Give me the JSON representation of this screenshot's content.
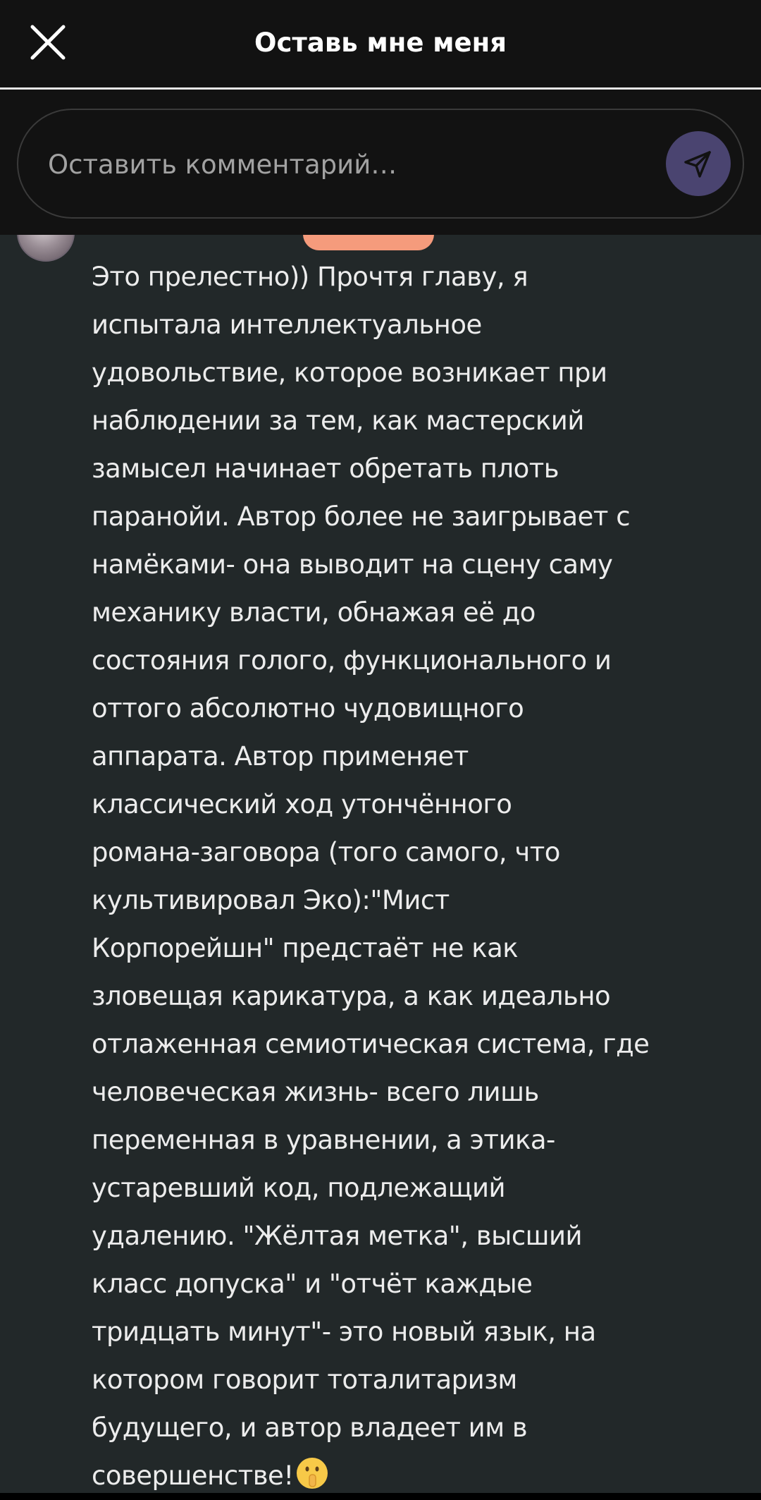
{
  "header": {
    "title": "Оставь мне меня",
    "close_icon": "close-icon"
  },
  "comment_input": {
    "placeholder": "Оставить комментарий…",
    "value": "",
    "send_icon": "send-icon",
    "send_color": "#4a4470"
  },
  "comment": {
    "text": "Это прелестно)) Прочтя главу, я\nиспытала интеллектуальное\nудовольствие, которое возникает при\nнаблюдении за тем, как мастерский\nзамысел начинает обретать плоть\nпаранойи. Автор более не заигрывает с\nнамёками- она выводит на сцену саму\nмеханику власти, обнажая её до\nсостояния голого, функционального и\nоттого абсолютно чудовищного\nаппарата. Автор применяет\nклассический ход утончённого\nромана-заговора (того самого, что\nкультивировал Эко):\"Мист\nКорпорейшн\" предстаёт не как\nзловещая карикатура, а как идеально\nотлаженная семиотическая система, где\nчеловеческая жизнь- всего лишь\nпеременная в уравнении, а этика-\nустаревший код, подлежащий\nудалению. \"Жёлтая метка\", высший\nкласс допуска\" и \"отчёт каждые\nтридцать минут\"- это новый язык, на\nкотором говорит тоталитаризм\nбудущего, и автор владеет им в\nсовершенстве!",
    "emoji": "shushing-face-emoji",
    "badge_color": "#f59b7c"
  },
  "colors": {
    "header_bg": "#121212",
    "content_bg": "#222829",
    "text": "#ececec"
  }
}
